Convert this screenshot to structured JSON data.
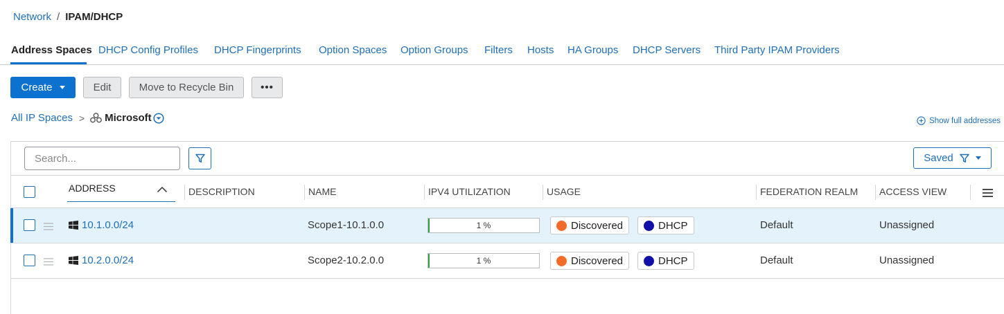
{
  "breadcrumb": {
    "root": "Network",
    "separator": "/",
    "current": "IPAM/DHCP"
  },
  "tabs": [
    {
      "label": "Address Spaces",
      "active": true
    },
    {
      "label": "DHCP Config Profiles"
    },
    {
      "label": "DHCP Fingerprints"
    },
    {
      "label": "Option Spaces"
    },
    {
      "label": "Option Groups"
    },
    {
      "label": "Filters"
    },
    {
      "label": "Hosts"
    },
    {
      "label": "HA Groups"
    },
    {
      "label": "DHCP Servers"
    },
    {
      "label": "Third Party IPAM Providers"
    }
  ],
  "toolbar": {
    "create_label": "Create",
    "edit_label": "Edit",
    "recycle_label": "Move to Recycle Bin",
    "more_label": "•••"
  },
  "space_crumb": {
    "root": "All IP Spaces",
    "chevron": ">",
    "space": "Microsoft",
    "space_icon": "ip-space-icon"
  },
  "show_full_label": "Show full addresses",
  "search": {
    "placeholder": "Search..."
  },
  "saved_label": "Saved",
  "columns": [
    "ADDRESS",
    "DESCRIPTION",
    "NAME",
    "IPV4 UTILIZATION",
    "USAGE",
    "FEDERATION REALM",
    "ACCESS VIEW"
  ],
  "rows": [
    {
      "address": "10.1.0.0/24",
      "description": "",
      "name": "Scope1-10.1.0.0",
      "utilization": "1 %",
      "utilization_value": 0.01,
      "usage": [
        {
          "label": "Discovered",
          "color": "#f26b2a"
        },
        {
          "label": "DHCP",
          "color": "#1010a8"
        }
      ],
      "realm": "Default",
      "access_view": "Unassigned",
      "selected": true
    },
    {
      "address": "10.2.0.0/24",
      "description": "",
      "name": "Scope2-10.2.0.0",
      "utilization": "1 %",
      "utilization_value": 0.01,
      "usage": [
        {
          "label": "Discovered",
          "color": "#f26b2a"
        },
        {
          "label": "DHCP",
          "color": "#1010a8"
        }
      ],
      "realm": "Default",
      "access_view": "Unassigned",
      "selected": false
    }
  ],
  "colors": {
    "accent": "#0d72cf",
    "link": "#1f6fb7",
    "selected_row": "#e4f2fb"
  }
}
